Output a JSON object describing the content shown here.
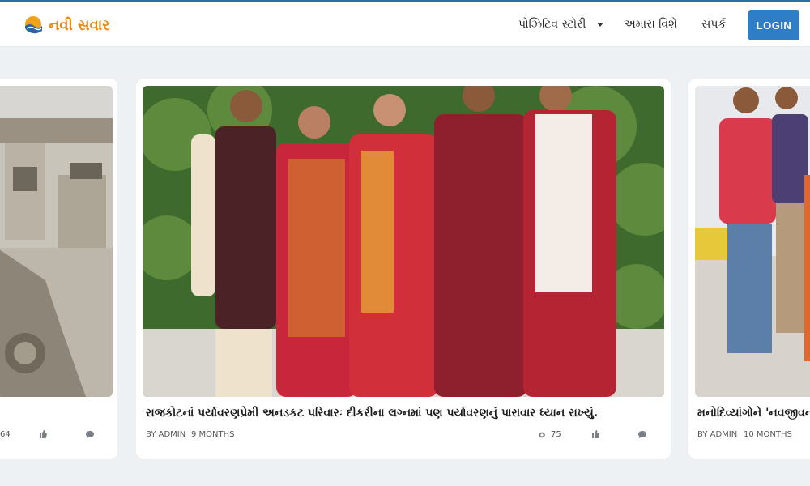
{
  "header": {
    "logo_text": "નવી સવાર",
    "nav": {
      "stories": "પોઝિટિવ સ્ટોરી",
      "about": "અમારા વિશે",
      "contact": "સંપર્ક"
    },
    "login_label": "LOGIN"
  },
  "cards": {
    "left": {
      "views": "64"
    },
    "center": {
      "title": "રાજકોટનાં પર્યાવરણપ્રેમી અનડકટ પરિવારઃ દીકરીના લગ્નમાં પણ પર્યાવરણનું પારાવાર ધ્યાન રાખ્યું.",
      "author": "BY ADMIN",
      "time": "9 MONTHS",
      "views": "75"
    },
    "right": {
      "title": "મનોદિવ્યાંગોને 'નવજીવન' આ",
      "author": "BY ADMIN",
      "time": "10 MONTHS"
    }
  },
  "icons": {
    "logo": "sun-wave-logo-icon",
    "caret": "chevron-down-icon",
    "views": "eye-icon",
    "likes": "thumbs-up-icon",
    "comments": "comment-icon"
  },
  "colors": {
    "accent": "#2f7dc4",
    "logo": "#e88c17",
    "background": "#eef1f4"
  }
}
